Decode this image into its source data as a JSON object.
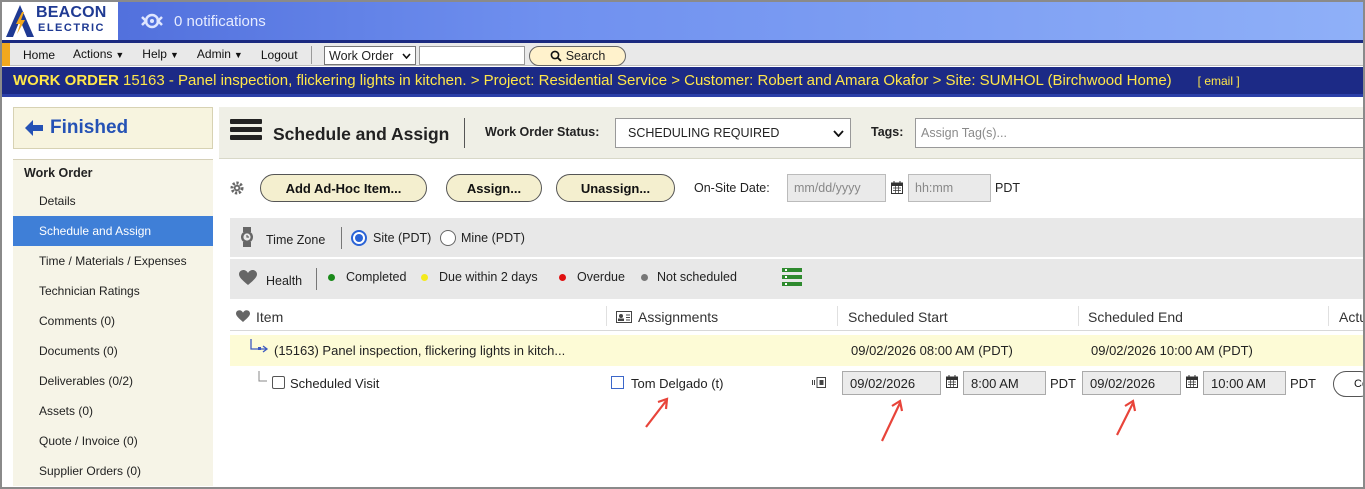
{
  "brand": {
    "line1": "BEACON",
    "line2": "ELECTRIC"
  },
  "notifications": {
    "text": "0 notifications"
  },
  "nav": {
    "items": [
      {
        "label": "Home",
        "caret": false
      },
      {
        "label": "Actions",
        "caret": true
      },
      {
        "label": "Help",
        "caret": true
      },
      {
        "label": "Admin",
        "caret": true
      },
      {
        "label": "Logout",
        "caret": false
      }
    ],
    "search_scope": "Work Order",
    "search_value": "",
    "search_button": "Search"
  },
  "work_order_strip": {
    "prefix": "WORK ORDER",
    "text": "15163 - Panel inspection, flickering lights in kitchen. > Project: Residential Service > Customer: Robert and Amara Okafor > Site: SUMHOL (Birchwood Home)",
    "email": "[ email ]"
  },
  "sidebar": {
    "finished_label": "Finished",
    "section_title": "Work Order",
    "items": [
      {
        "label": "Details",
        "active": false
      },
      {
        "label": "Schedule and Assign",
        "active": true
      },
      {
        "label": "Time / Materials / Expenses",
        "active": false
      },
      {
        "label": "Technician Ratings",
        "active": false
      },
      {
        "label": "Comments (0)",
        "active": false
      },
      {
        "label": "Documents (0)",
        "active": false
      },
      {
        "label": "Deliverables (0/2)",
        "active": false
      },
      {
        "label": "Assets (0)",
        "active": false
      },
      {
        "label": "Quote / Invoice (0)",
        "active": false
      },
      {
        "label": "Supplier Orders (0)",
        "active": false
      }
    ]
  },
  "header": {
    "title": "Schedule and Assign",
    "status_label": "Work Order Status:",
    "status_value": "SCHEDULING REQUIRED",
    "tags_label": "Tags:",
    "tags_placeholder": "Assign Tag(s)..."
  },
  "actions": {
    "add_adhoc": "Add Ad-Hoc Item...",
    "assign": "Assign...",
    "unassign": "Unassign...",
    "onsite_label": "On-Site Date:",
    "date_placeholder": "mm/dd/yyyy",
    "time_placeholder": "hh:mm",
    "tz": "PDT"
  },
  "timezone": {
    "label": "Time Zone",
    "site": "Site (PDT)",
    "mine": "Mine (PDT)",
    "selected": "site"
  },
  "health": {
    "label": "Health",
    "legend": [
      {
        "label": "Completed",
        "color": "#1a8a1a"
      },
      {
        "label": "Due within 2 days",
        "color": "#f4ea1d"
      },
      {
        "label": "Overdue",
        "color": "#e01010"
      },
      {
        "label": "Not scheduled",
        "color": "#777777"
      }
    ]
  },
  "table": {
    "columns": [
      "Item",
      "Assignments",
      "Scheduled Start",
      "Scheduled End",
      "Actu"
    ],
    "parent_row": {
      "item": "(15163) Panel inspection, flickering lights in kitch...",
      "start": "09/02/2026 08:00 AM (PDT)",
      "end": "09/02/2026 10:00 AM (PDT)"
    },
    "visit_row": {
      "item": "Scheduled Visit",
      "assignee": "Tom Delgado (t)",
      "start_date": "09/02/2026",
      "start_time": "8:00 AM",
      "start_tz": "PDT",
      "end_date": "09/02/2026",
      "end_time": "10:00 AM",
      "end_tz": "PDT",
      "action_label": "Co"
    }
  },
  "colors": {
    "accent_blue": "#3f7fd7",
    "strip_navy": "#1c2a86",
    "strip_text": "#ffe74a",
    "annotation_red": "#e8443a"
  }
}
